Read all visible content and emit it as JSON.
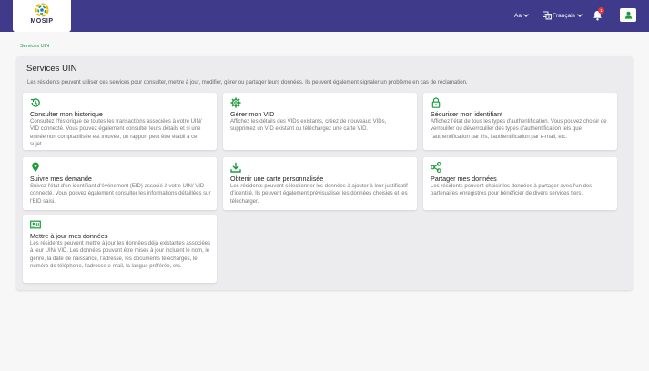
{
  "header": {
    "logo_text": "MOSIP",
    "font_size_label": "Aa",
    "language_label": "Français",
    "notification_count": "1",
    "colors": {
      "bar": "#3f3a89",
      "accent": "#1a9c3c"
    },
    "icons": [
      "translate-icon",
      "bell-icon",
      "user-icon",
      "chevron-down-icon"
    ]
  },
  "breadcrumb": "Services UIN",
  "panel": {
    "title": "Services UIN",
    "description": "Les résidents peuvent utiliser ces services pour consulter, mettre à jour, modifier, gérer ou partager leurs données. Ils peuvent également signaler un problème en cas de réclamation."
  },
  "cards": [
    {
      "icon": "history-icon",
      "title": "Consulter mon historique",
      "description": "Consultez l'historique de toutes les transactions associées à votre UIN/ VID connecté. Vous pouvez également consulter leurs détails et si une entrée non comptabilisée est trouvée, un rapport peut être établi à ce sujet."
    },
    {
      "icon": "gear-icon",
      "title": "Gérer mon VID",
      "description": "Affichez les détails des VIDs existants, créez de nouveaux VIDs, supprimez un VID existant ou téléchargez une carte VID."
    },
    {
      "icon": "lock-icon",
      "title": "Sécuriser mon identifiant",
      "description": "Affichez l'état de tous les types d'authentification. Vous pouvez choisir de verrouiller ou déverrouiller des types d'authentification tels que l'authentification par iris, l'authentification par e-mail, etc."
    },
    {
      "icon": "location-pin-icon",
      "title": "Suivre mes demande",
      "description": "Suivez l'état d'un identifiant d'événement (EID) associé à votre UIN/ VID connecté. Vous pouvez également consulter les informations détaillées sur l'EID saisi."
    },
    {
      "icon": "download-icon",
      "title": "Obtenir une carte personnalisée",
      "description": "Les résidents peuvent sélectionner les données à ajouter à leur justificatif d'identité. Ils peuvent également prévisualiser les données choisies et les télécharger."
    },
    {
      "icon": "share-icon",
      "title": "Partager mes données",
      "description": "Les résidents peuvent choisir les données à partager avec l'un des partenaires enregistrés pour bénéficier de divers services tiers."
    },
    {
      "icon": "id-card-icon",
      "title": "Mettre à jour mes données",
      "description": "Les résidents peuvent mettre à jour les données déjà existantes associées à leur UIN/ VID. Les données pouvant être mises à jour incluent le nom, le genre, la date de naissance, l'adresse, les documents téléchargés, le numéro de téléphone, l'adresse e-mail, la langue préférée, etc."
    }
  ]
}
